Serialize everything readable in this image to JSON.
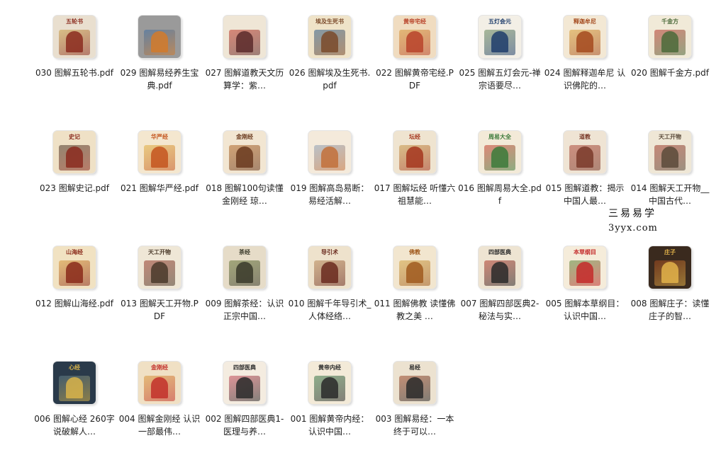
{
  "files": [
    {
      "label": "030 图解五轮书.pdf",
      "cover_title": "五轮书",
      "colors": [
        "#e9dfcf",
        "#8b2b1e",
        "#c9a24a"
      ]
    },
    {
      "label": "029 图解易经养生宝典.pdf",
      "cover_title": "",
      "colors": [
        "#9a9a9a",
        "#d27a2a",
        "#3b6ea5"
      ]
    },
    {
      "label": "027 图解道教天文历算学：紫…",
      "cover_title": "",
      "colors": [
        "#efe6d6",
        "#5a2a2a",
        "#c23b2a"
      ]
    },
    {
      "label": "026 图解埃及生死书.pdf",
      "cover_title": "埃及生死书",
      "colors": [
        "#efe3c8",
        "#7a4a2a",
        "#2d5d8a"
      ]
    },
    {
      "label": "022 图解黄帝宅经.PDF",
      "cover_title": "黄帝宅经",
      "colors": [
        "#f0dcc0",
        "#b8432a",
        "#d79a3a"
      ]
    },
    {
      "label": "025 图解五灯会元-禅宗语要尽…",
      "cover_title": "五灯会元",
      "colors": [
        "#f3efe6",
        "#1e3d6b",
        "#6a8a5a"
      ]
    },
    {
      "label": "024 图解释迦牟尼 认识佛陀的…",
      "cover_title": "释迦牟尼",
      "colors": [
        "#f3e8d4",
        "#a44a1e",
        "#d9a23a"
      ]
    },
    {
      "label": "020 图解千金方.pdf",
      "cover_title": "千金方",
      "colors": [
        "#f1ead8",
        "#4b6a3a",
        "#b9352a"
      ]
    },
    {
      "label": "023 图解史记.pdf",
      "cover_title": "史记",
      "colors": [
        "#efe1c6",
        "#8a2a1e",
        "#4a3a2a"
      ]
    },
    {
      "label": "021 图解华严经.pdf",
      "cover_title": "华严经",
      "colors": [
        "#f4e7cf",
        "#c4551e",
        "#e0b040"
      ]
    },
    {
      "label": "018 图解100句读懂金刚经 琼…",
      "cover_title": "金刚经",
      "colors": [
        "#f2e6d2",
        "#6a3a1e",
        "#b36a2a"
      ]
    },
    {
      "label": "019 图解高岛易断：易经活解…",
      "cover_title": "",
      "colors": [
        "#f4eadb",
        "#c2703a",
        "#8aa0b8"
      ]
    },
    {
      "label": "017 图解坛经 听懂六祖慧能…",
      "cover_title": "坛经",
      "colors": [
        "#efe4d0",
        "#a5361e",
        "#c79a4a"
      ]
    },
    {
      "label": "016 图解周易大全.pdf",
      "cover_title": "周易大全",
      "colors": [
        "#f3ead8",
        "#3b7a3a",
        "#c93a2a"
      ]
    },
    {
      "label": "015 图解道教：揭示中国人最…",
      "cover_title": "道教",
      "colors": [
        "#efe4d4",
        "#7a3a2a",
        "#b04a3a"
      ]
    },
    {
      "label": "014 图解天工开物__中国古代…",
      "cover_title": "天工开物",
      "colors": [
        "#efe7d6",
        "#5a4a3a",
        "#a23a2a"
      ]
    },
    {
      "label": "012 图解山海经.pdf",
      "cover_title": "山海经",
      "colors": [
        "#f1e2c2",
        "#8a2a1a",
        "#d99a3a"
      ]
    },
    {
      "label": "013 图解天工开物.PDF",
      "cover_title": "天工开物",
      "colors": [
        "#efe7d6",
        "#4a3a2a",
        "#9a3a2a"
      ]
    },
    {
      "label": "009 图解茶经：认识正宗中国…",
      "cover_title": "茶经",
      "colors": [
        "#e6dcc8",
        "#3a3a2a",
        "#6a7a3a"
      ]
    },
    {
      "label": "010 图解千年导引术_人体经络…",
      "cover_title": "导引术",
      "colors": [
        "#eee2cc",
        "#6a2a1e",
        "#b98a5a"
      ]
    },
    {
      "label": "011 图解佛教 读懂佛教之美 …",
      "cover_title": "佛教",
      "colors": [
        "#f2e6cf",
        "#a05a1e",
        "#d4a848"
      ]
    },
    {
      "label": "007 图解四部医典2-秘法与实…",
      "cover_title": "四部医典",
      "colors": [
        "#eee4d2",
        "#2a2a2a",
        "#b43a2a"
      ]
    },
    {
      "label": "005 图解本草纲目：认识中国…",
      "cover_title": "本草纲目",
      "colors": [
        "#f5ecda",
        "#c42a2a",
        "#5a8a3a"
      ]
    },
    {
      "label": "008 图解庄子：读懂庄子的智…",
      "cover_title": "庄子",
      "colors": [
        "#3a2a1e",
        "#e3b34a",
        "#a0471e"
      ]
    },
    {
      "label": "006 图解心经 260字说破解人…",
      "cover_title": "心经",
      "colors": [
        "#2a3a4a",
        "#d9b44a",
        "#5a7a8a"
      ]
    },
    {
      "label": "004 图解金刚经 认识一部最伟…",
      "cover_title": "金刚经",
      "colors": [
        "#f0e0c4",
        "#c2302a",
        "#d99a3a"
      ]
    },
    {
      "label": "002 图解四部医典1-医理与养…",
      "cover_title": "四部医典",
      "colors": [
        "#f4ece0",
        "#2a2a2a",
        "#c94a5a"
      ]
    },
    {
      "label": "001 图解黄帝内经：认识中国…",
      "cover_title": "黄帝内经",
      "colors": [
        "#f3ead8",
        "#2a2a2a",
        "#3a7a4a"
      ]
    },
    {
      "label": "003 图解易经：一本终于可以…",
      "cover_title": "易经",
      "colors": [
        "#ece2d0",
        "#2a2a2a",
        "#a04a2a"
      ]
    }
  ],
  "watermark": {
    "name": "三易易学",
    "url": "3yyx.com"
  }
}
